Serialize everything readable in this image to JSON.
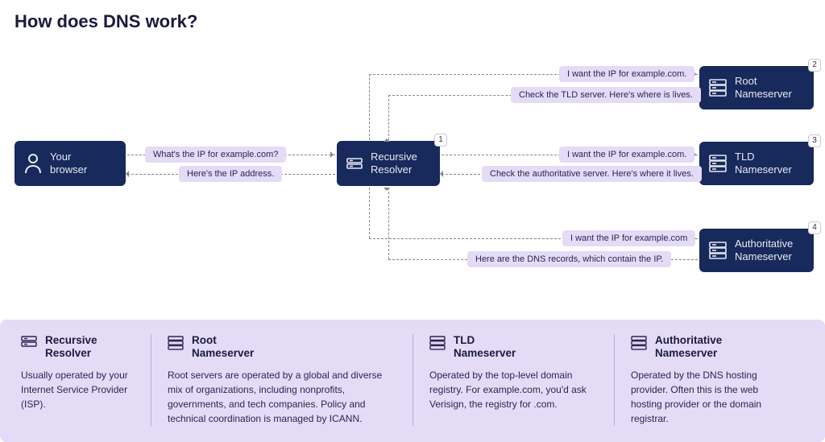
{
  "title": "How does DNS work?",
  "nodes": {
    "browser": {
      "label": "Your\nbrowser"
    },
    "resolver": {
      "label": "Recursive\nResolver",
      "badge": "1"
    },
    "root": {
      "label": "Root\nNameserver",
      "badge": "2"
    },
    "tld": {
      "label": "TLD\nNameserver",
      "badge": "3"
    },
    "auth": {
      "label": "Authoritative\nNameserver",
      "badge": "4"
    }
  },
  "messages": {
    "br_to_res": "What's the IP for example.com?",
    "res_to_br": "Here's the IP address.",
    "res_to_root": "I want the IP for example.com.",
    "root_to_res": "Check the TLD server. Here's where is lives.",
    "res_to_tld": "I want the IP for example.com.",
    "tld_to_res": "Check the authoritative server. Here's where it lives.",
    "res_to_auth": "I want the IP for example.com",
    "auth_to_res": "Here are the DNS records, which contain the IP."
  },
  "legend": {
    "resolver": {
      "title": "Recursive\nResolver",
      "desc": "Usually operated by your Internet Service Provider (ISP)."
    },
    "root": {
      "title": "Root\nNameserver",
      "desc": "Root servers are operated by a global and diverse mix of organizations, including nonprofits, governments, and tech companies. Policy and technical coordination is managed by ICANN."
    },
    "tld": {
      "title": "TLD\nNameserver",
      "desc": "Operated by the top-level domain registry. For example.com, you'd ask Verisign, the registry for .com."
    },
    "auth": {
      "title": "Authoritative\nNameserver",
      "desc": "Operated by the DNS hosting provider. Often this is the web hosting provider or the domain registrar."
    }
  },
  "colors": {
    "node_bg": "#182a5b",
    "msg_bg": "#e4dbf7",
    "dash": "#888"
  }
}
